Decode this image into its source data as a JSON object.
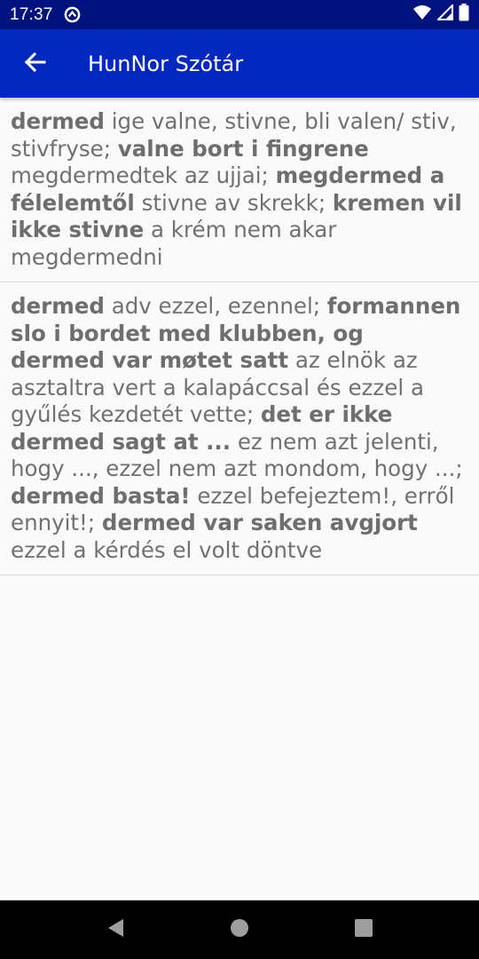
{
  "status_bar": {
    "time": "17:37",
    "icons": [
      "sync-icon",
      "wifi-icon",
      "signal-icon",
      "battery-icon"
    ]
  },
  "app_bar": {
    "title": "HunNor Szótár",
    "back_icon": "arrow-left-icon"
  },
  "entries": [
    {
      "segments": [
        {
          "t": "dermed",
          "b": true
        },
        {
          "t": " ige valne, stivne, bli valen/ stiv, stivfryse; ",
          "b": false
        },
        {
          "t": "valne bort i fingrene",
          "b": true
        },
        {
          "t": " megdermedtek az ujjai; ",
          "b": false
        },
        {
          "t": "megdermed a félelemtől",
          "b": true
        },
        {
          "t": " stivne av skrekk; ",
          "b": false
        },
        {
          "t": "kremen vil ikke stivne",
          "b": true
        },
        {
          "t": " a krém nem akar megdermedni",
          "b": false
        }
      ]
    },
    {
      "segments": [
        {
          "t": "dermed",
          "b": true
        },
        {
          "t": " adv ezzel, ezennel; ",
          "b": false
        },
        {
          "t": "formannen slo i bordet med klubben, og dermed var møtet satt",
          "b": true
        },
        {
          "t": " az elnök az asztaltra vert a kalapáccsal és ezzel a gyűlés kezdetét vette; ",
          "b": false
        },
        {
          "t": "det er ikke dermed sagt at ...",
          "b": true
        },
        {
          "t": " ez nem azt jelenti, hogy ..., ezzel nem azt mondom, hogy ...; ",
          "b": false
        },
        {
          "t": "dermed basta!",
          "b": true
        },
        {
          "t": " ezzel befejeztem!, erről ennyit!; ",
          "b": false
        },
        {
          "t": "dermed var saken avgjort",
          "b": true
        },
        {
          "t": " ezzel a kérdés el volt döntve",
          "b": false
        }
      ]
    }
  ],
  "nav_bar": {
    "buttons": [
      "back-triangle-icon",
      "home-circle-icon",
      "recents-square-icon"
    ]
  },
  "colors": {
    "status_bar": "#00127e",
    "app_bar": "#0328c0",
    "entry_text": "#707070",
    "background": "#fafafa"
  }
}
